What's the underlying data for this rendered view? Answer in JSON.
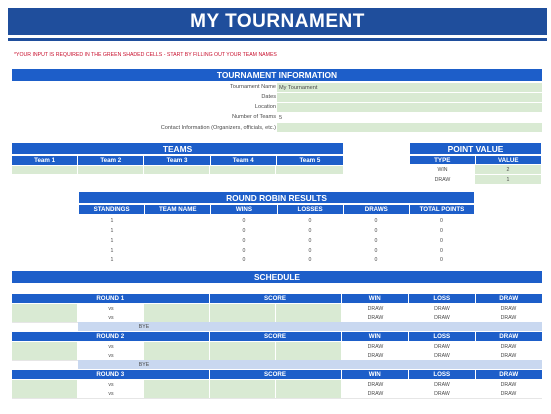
{
  "title": "MY TOURNAMENT",
  "notice": "*YOUR INPUT IS REQUIRED IN THE GREEN SHADED CELLS - START BY FILLING OUT YOUR TEAM NAMES",
  "tournament_info": {
    "header": "TOURNAMENT INFORMATION",
    "fields": [
      {
        "label": "Tournament Name",
        "value": "My Tournament"
      },
      {
        "label": "Dates",
        "value": ""
      },
      {
        "label": "Location",
        "value": ""
      },
      {
        "label": "Number of Teams",
        "value": "5"
      },
      {
        "label": "Contact Information (Organizers, officials, etc.)",
        "value": ""
      }
    ]
  },
  "teams": {
    "header": "TEAMS",
    "columns": [
      "Team 1",
      "Team 2",
      "Team 3",
      "Team 4",
      "Team 5"
    ]
  },
  "point_value": {
    "header": "POINT VALUE",
    "columns": [
      "TYPE",
      "VALUE"
    ],
    "rows": [
      {
        "type": "WIN",
        "value": "2"
      },
      {
        "type": "DRAW",
        "value": "1"
      }
    ]
  },
  "round_robin": {
    "header": "ROUND ROBIN RESULTS",
    "columns": [
      "STANDINGS",
      "TEAM NAME",
      "WINS",
      "LOSSES",
      "DRAWS",
      "TOTAL POINTS"
    ],
    "rows": [
      {
        "standing": "1",
        "team": "",
        "wins": "0",
        "losses": "0",
        "draws": "0",
        "total": "0"
      },
      {
        "standing": "1",
        "team": "",
        "wins": "0",
        "losses": "0",
        "draws": "0",
        "total": "0"
      },
      {
        "standing": "1",
        "team": "",
        "wins": "0",
        "losses": "0",
        "draws": "0",
        "total": "0"
      },
      {
        "standing": "1",
        "team": "",
        "wins": "0",
        "losses": "0",
        "draws": "0",
        "total": "0"
      },
      {
        "standing": "1",
        "team": "",
        "wins": "0",
        "losses": "0",
        "draws": "0",
        "total": "0"
      }
    ]
  },
  "schedule": {
    "header": "SCHEDULE",
    "rounds": [
      {
        "label": "ROUND 1",
        "columns": [
          "SCORE",
          "WIN",
          "LOSS",
          "DRAW"
        ],
        "matches": [
          {
            "vs": "vs",
            "win": "DRAW",
            "loss": "DRAW",
            "draw": "DRAW"
          },
          {
            "vs": "vs",
            "win": "DRAW",
            "loss": "DRAW",
            "draw": "DRAW"
          }
        ],
        "bye": "BYE"
      },
      {
        "label": "ROUND 2",
        "columns": [
          "SCORE",
          "WIN",
          "LOSS",
          "DRAW"
        ],
        "matches": [
          {
            "vs": "vs",
            "win": "DRAW",
            "loss": "DRAW",
            "draw": "DRAW"
          },
          {
            "vs": "vs",
            "win": "DRAW",
            "loss": "DRAW",
            "draw": "DRAW"
          }
        ],
        "bye": "BYE"
      },
      {
        "label": "ROUND 3",
        "columns": [
          "SCORE",
          "WIN",
          "LOSS",
          "DRAW"
        ],
        "matches": [
          {
            "vs": "vs",
            "win": "DRAW",
            "loss": "DRAW",
            "draw": "DRAW"
          },
          {
            "vs": "vs",
            "win": "DRAW",
            "loss": "DRAW",
            "draw": "DRAW"
          }
        ]
      }
    ]
  }
}
